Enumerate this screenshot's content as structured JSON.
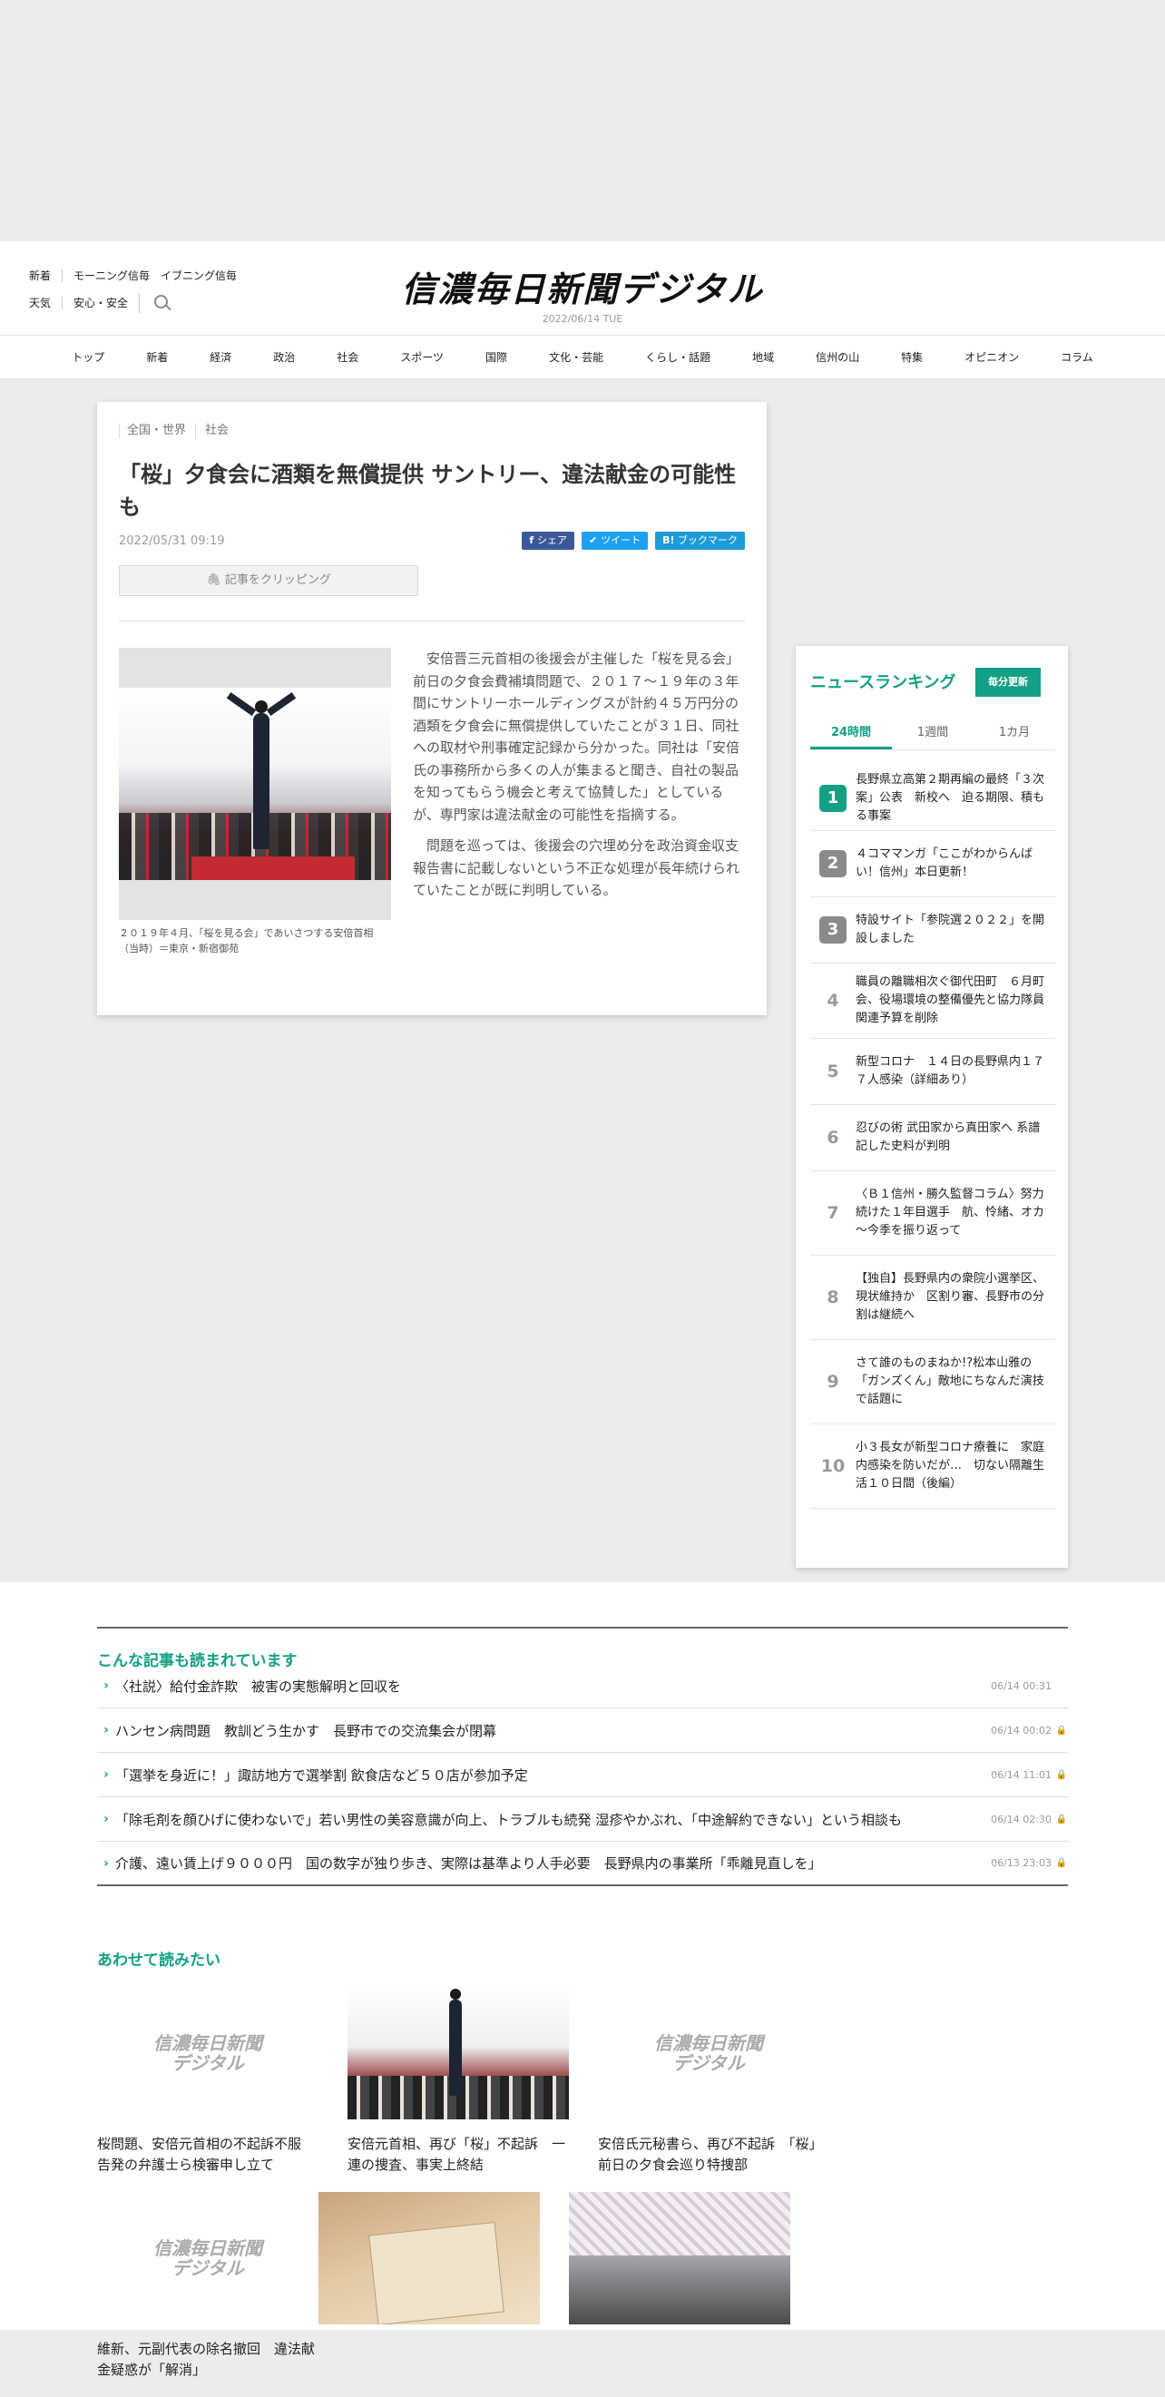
{
  "header": {
    "links_row1": [
      "新着",
      "モーニング信毎",
      "イブニング信毎"
    ],
    "links_row2": [
      "天気",
      "安心・安全"
    ],
    "logo": "信濃毎日新聞デジタル",
    "date": "2022/06/14 TUE"
  },
  "nav": [
    "トップ",
    "新着",
    "経済",
    "政治",
    "社会",
    "スポーツ",
    "国際",
    "文化・芸能",
    "くらし・話題",
    "地域",
    "信州の山",
    "特集",
    "オピニオン",
    "コラム"
  ],
  "article": {
    "categories": [
      "全国・世界",
      "社会"
    ],
    "title": "「桜」夕食会に酒類を無償提供 サントリー、違法献金の可能性も",
    "date": "2022/05/31 09:19",
    "share": {
      "facebook": "シェア",
      "twitter": "ツイート",
      "hatena": "ブックマーク",
      "hatena_mark": "B!"
    },
    "clip_label": "記事をクリッピング",
    "caption": "２０１９年４月、「桜を見る会」であいさつする安倍首相（当時）＝東京・新宿御苑",
    "paragraphs": [
      "安倍晋三元首相の後援会が主催した「桜を見る会」前日の夕食会費補填問題で、２０１７～１９年の３年間にサントリーホールディングスが計約４５万円分の酒類を夕食会に無償提供していたことが３１日、同社への取材や刑事確定記録から分かった。同社は「安倍氏の事務所から多くの人が集まると聞き、自社の製品を知ってもらう機会と考えて協賛した」としているが、専門家は違法献金の可能性を指摘する。",
      "問題を巡っては、後援会の穴埋め分を政治資金収支報告書に記載しないという不正な処理が長年続けられていたことが既に判明している。"
    ]
  },
  "ranking": {
    "title": "ニュースランキング",
    "update_label": "毎分更新",
    "tabs": [
      "24時間",
      "1週間",
      "1カ月"
    ],
    "items": [
      {
        "rank": "1",
        "text": "長野県立高第２期再編の最終「３次案」公表　新校へ　迫る期限、積もる事案"
      },
      {
        "rank": "2",
        "text": "４コママンガ「ここがわからんばい！信州」本日更新！"
      },
      {
        "rank": "3",
        "text": "特設サイト「参院選２０２２」を開設しました"
      },
      {
        "rank": "4",
        "text": "職員の離職相次ぐ御代田町　６月町会、役場環境の整備優先と協力隊員関連予算を削除"
      },
      {
        "rank": "5",
        "text": "新型コロナ　１４日の長野県内１７７人感染（詳細あり）"
      },
      {
        "rank": "6",
        "text": "忍びの術 武田家から真田家へ 系譜記した史料が判明"
      },
      {
        "rank": "7",
        "text": "〈Ｂ１信州・勝久監督コラム〉努力続けた１年目選手　航、怜緒、オカ～今季を振り返って"
      },
      {
        "rank": "8",
        "text": "【独自】長野県内の衆院小選挙区、現状維持か　区割り審、長野市の分割は継続へ"
      },
      {
        "rank": "9",
        "text": "さて誰のものまねか!?松本山雅の「ガンズくん」敵地にちなんだ演技で話題に"
      },
      {
        "rank": "10",
        "text": "小３長女が新型コロナ療養に　家庭内感染を防いだが…　切ない隔離生活１０日間（後編）"
      }
    ],
    "top_color": "#13a085",
    "mid_color": "#8a8a8a"
  },
  "related": {
    "title": "こんな記事も読まれています",
    "items": [
      {
        "text": "〈社説〉給付金詐欺　被害の実態解明と回収を",
        "date": "06/14 00:31",
        "locked": false
      },
      {
        "text": "ハンセン病問題　教訓どう生かす　長野市での交流集会が閉幕",
        "date": "06/14 00:02",
        "locked": true
      },
      {
        "text": "「選挙を身近に！」諏訪地方で選挙割 飲食店など５０店が参加予定",
        "date": "06/14 11:01",
        "locked": true
      },
      {
        "text": "「除毛剤を顔ひげに使わないで」若い男性の美容意識が向上、トラブルも続発 湿疹やかぶれ、「中途解約できない」という相談も",
        "date": "06/14 02:30",
        "locked": true
      },
      {
        "text": "介護、遠い賃上げ９０００円　国の数字が独り歩き、実際は基準より人手必要　長野県内の事業所「乖離見直しを」",
        "date": "06/13 23:03",
        "locked": true
      }
    ]
  },
  "also_read": {
    "title": "あわせて読みたい",
    "logo_text": "信濃毎日新聞 デジタル",
    "cards": [
      {
        "title": "桜問題、安倍元首相の不起訴不服　告発の弁護士ら検審申し立て",
        "thumb": "logo"
      },
      {
        "title": "安倍元首相、再び「桜」不起訴　一連の捜査、事実上終結",
        "thumb": "photo1"
      },
      {
        "title": "安倍氏元秘書ら、再び不起訴　「桜」前日の夕食会巡り特捜部",
        "thumb": "logo"
      },
      {
        "title": "維新、元副代表の除名撤回　違法献金疑惑が「解消」",
        "thumb": "logo"
      },
      {
        "title": "",
        "thumb": "photo2"
      },
      {
        "title": "",
        "thumb": "photo3"
      }
    ]
  }
}
